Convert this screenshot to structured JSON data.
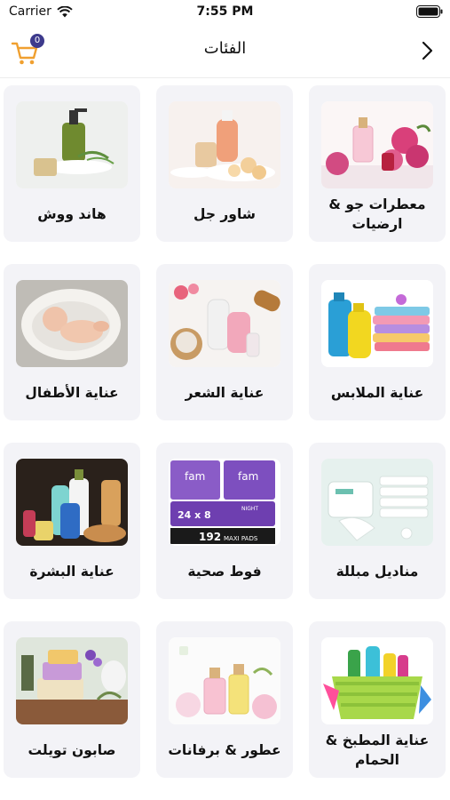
{
  "status_bar": {
    "carrier": "Carrier",
    "time": "7:55 PM"
  },
  "nav": {
    "title": "الفئات",
    "cart_count": "0",
    "cart_icon": "cart-icon",
    "back_icon": "chevron-right-icon"
  },
  "colors": {
    "accent_orange": "#f0a030",
    "badge": "#3d3a8c",
    "card_bg": "#f3f3f7"
  },
  "categories": [
    {
      "label": "معطرات جو & ارضيات",
      "image": "perfume-roses"
    },
    {
      "label": "شاور جل",
      "image": "shower-gel"
    },
    {
      "label": "هاند ووش",
      "image": "hand-wash"
    },
    {
      "label": "عناية الملابس",
      "image": "laundry-detergent"
    },
    {
      "label": "عناية الشعر",
      "image": "hair-care"
    },
    {
      "label": "عناية الأطفال",
      "image": "baby"
    },
    {
      "label": "مناديل مبللة",
      "image": "wet-wipes"
    },
    {
      "label": "فوط صحية",
      "image": "sanitary-pads"
    },
    {
      "label": "عناية البشرة",
      "image": "skin-care"
    },
    {
      "label": "عناية المطبخ & الحمام",
      "image": "cleaning-basket"
    },
    {
      "label": "عطور & برفانات",
      "image": "perfume-bottles"
    },
    {
      "label": "صابون تويلت",
      "image": "soap-bars"
    }
  ],
  "pads_packaging": {
    "brand": "fam",
    "count": "24 x 8",
    "size": "192",
    "type": "MAXI PADS",
    "variant": "NIGHT"
  }
}
